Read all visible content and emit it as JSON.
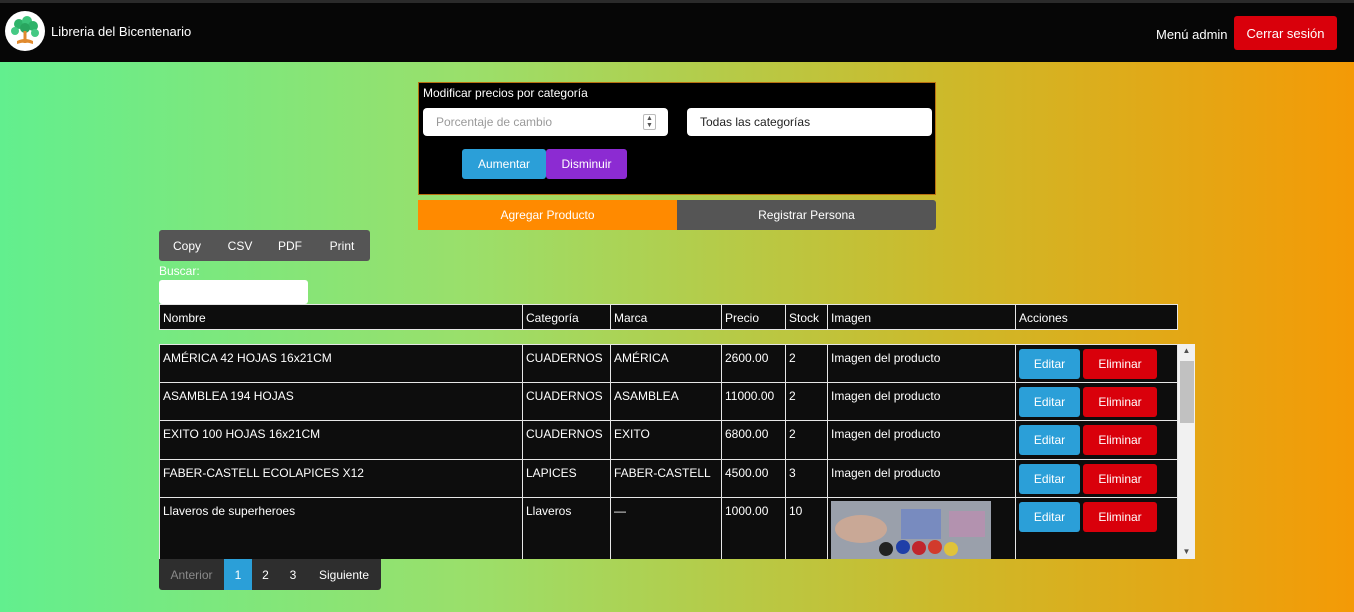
{
  "header": {
    "brand": "Libreria del Bicentenario",
    "admin_menu": "Menú admin",
    "logout": "Cerrar sesión"
  },
  "price_panel": {
    "title": "Modificar precios por categoría",
    "percent_placeholder": "Porcentaje de cambio",
    "category_selected": "Todas las categorías",
    "increase": "Aumentar",
    "decrease": "Disminuir"
  },
  "actions": {
    "add_product": "Agregar Producto",
    "register_person": "Registrar Persona"
  },
  "export": {
    "copy": "Copy",
    "csv": "CSV",
    "pdf": "PDF",
    "print": "Print"
  },
  "search": {
    "label": "Buscar:"
  },
  "table": {
    "columns": [
      "Nombre",
      "Categoría",
      "Marca",
      "Precio",
      "Stock",
      "Imagen",
      "Acciones"
    ],
    "rows": [
      {
        "name": "AMÉRICA 42 HOJAS 16x21CM",
        "category": "CUADERNOS",
        "brand": "AMÉRICA",
        "price": "2600.00",
        "stock": "2",
        "image": "Imagen del producto"
      },
      {
        "name": "ASAMBLEA 194 HOJAS",
        "category": "CUADERNOS",
        "brand": "ASAMBLEA",
        "price": "11000.00",
        "stock": "2",
        "image": "Imagen del producto"
      },
      {
        "name": "EXITO 100 HOJAS 16x21CM",
        "category": "CUADERNOS",
        "brand": "EXITO",
        "price": "6800.00",
        "stock": "2",
        "image": "Imagen del producto"
      },
      {
        "name": "FABER-CASTELL ECOLAPICES X12",
        "category": "LAPICES",
        "brand": "FABER-CASTELL",
        "price": "4500.00",
        "stock": "3",
        "image": "Imagen del producto"
      },
      {
        "name": "Llaveros de superheroes",
        "category": "Llaveros",
        "brand": "—",
        "price": "1000.00",
        "stock": "10",
        "image": ""
      }
    ],
    "edit_label": "Editar",
    "delete_label": "Eliminar"
  },
  "pagination": {
    "prev": "Anterior",
    "pages": [
      "1",
      "2",
      "3"
    ],
    "active": "1",
    "next": "Siguiente"
  },
  "colors": {
    "accent_blue": "#2b9fd8",
    "danger_red": "#d9000b",
    "orange": "#ff8a00",
    "purple": "#8c2bd2"
  }
}
